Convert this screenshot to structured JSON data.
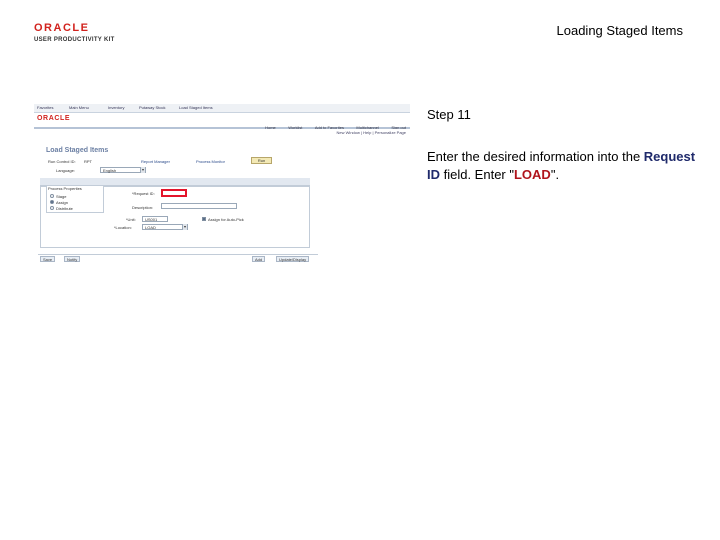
{
  "header": {
    "logo_word": "ORACLE",
    "logo_sub": "USER PRODUCTIVITY KIT",
    "title": "Loading Staged Items"
  },
  "screenshot": {
    "topnav": [
      "Favorites",
      "Main Menu",
      "Inventory",
      "Putaway Stock",
      "Load Staged Items"
    ],
    "brand": "ORACLE",
    "links": [
      "Home",
      "Worklist",
      "Add to Favorites",
      "Multichannel",
      "Sign out"
    ],
    "subbar": "New Window | Help | Personalize Page",
    "page_heading": "Load Staged Items",
    "fields": {
      "run_control_label": "Run Control ID:",
      "run_control_value": "RPT",
      "report_manager": "Report Manager",
      "process_monitor": "Process Monitor",
      "run_button": "Run",
      "language_label": "Language:",
      "language_value": "English",
      "process_properties": "Process Properties",
      "radio_options": [
        "Stage",
        "Assign",
        "Distribute"
      ],
      "request_id_label": "*Request ID:",
      "description_label": "Description:",
      "unit_label": "*Unit:",
      "unit_value": "US001",
      "checkbox_label": "Assign for Auto-Pick",
      "location_label": "*Location:",
      "location_value": "LOAD"
    },
    "bottom_buttons": [
      "Save",
      "Notify",
      "Add",
      "Update/Display"
    ]
  },
  "instructions": {
    "step": "Step 11",
    "text_before": "Enter the desired information into the ",
    "field_name": "Request ID",
    "text_middle": " field. Enter \"",
    "value": "LOAD",
    "text_after": "\"."
  },
  "colors": {
    "oracle_red": "#d2231e",
    "highlight_red": "#e4142b",
    "field_name_color": "#1f2a6b",
    "value_color": "#b0141c"
  }
}
